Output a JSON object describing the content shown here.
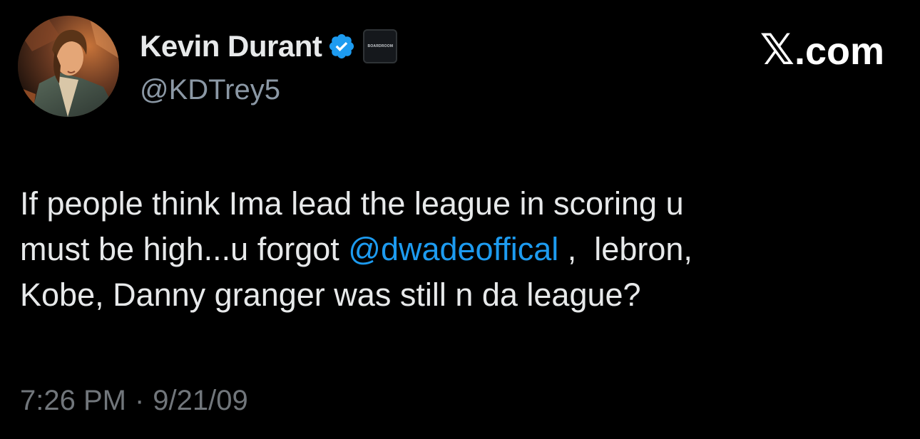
{
  "author": {
    "display_name": "Kevin Durant",
    "handle": "@KDTrey5",
    "affiliate_badge_text": "BOARDROOM",
    "verified": true,
    "avatar_icon": "profile-photo"
  },
  "brand": {
    "logo_glyph": "𝕏",
    "domain": ".com"
  },
  "tweet": {
    "line1": "If people think Ima lead the league in scoring u",
    "line2_before": "must be high...u forgot ",
    "mention": "@dwadeoffical",
    "line2_after": " ,  lebron,",
    "line3": "Kobe, Danny granger was still n da league?"
  },
  "meta": {
    "time": "7:26 PM",
    "separator": "·",
    "date": "9/21/09"
  },
  "colors": {
    "background": "#000000",
    "text": "#e7e9ea",
    "secondary": "#71767b",
    "mention": "#1d9bf0",
    "verified": "#1d9bf0"
  }
}
